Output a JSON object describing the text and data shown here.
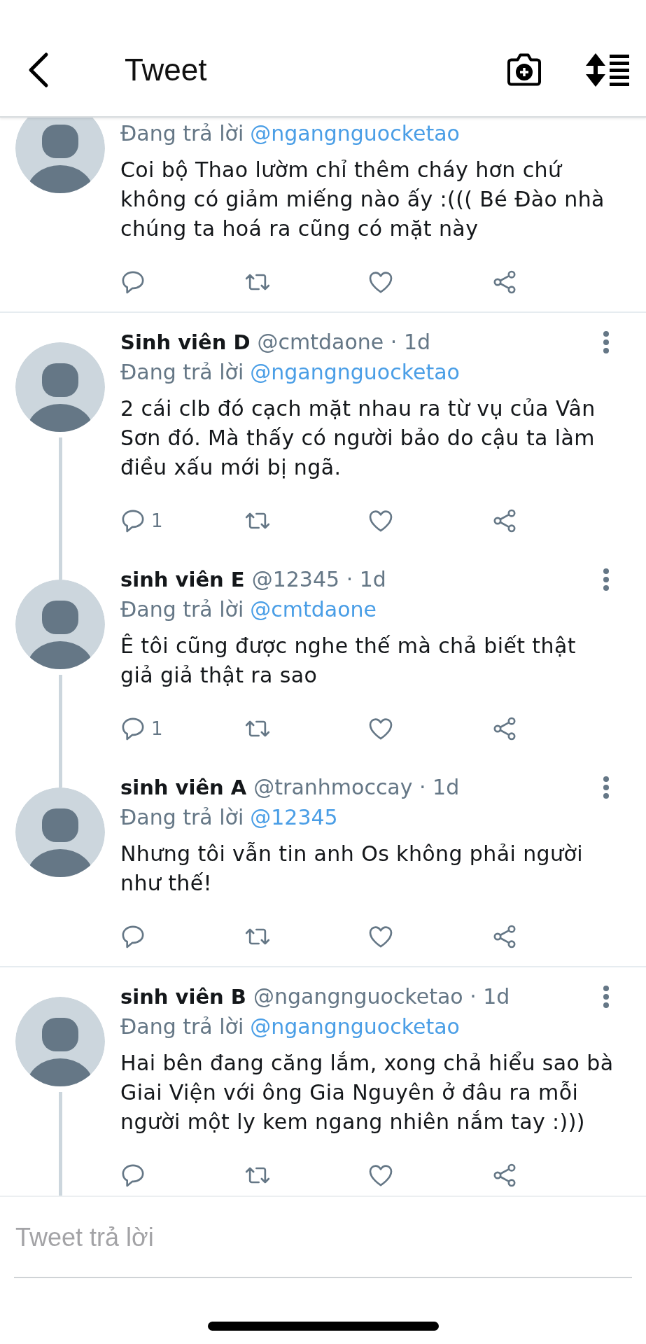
{
  "header": {
    "title": "Tweet"
  },
  "tweets": [
    {
      "reply_label": "Đang trả lời",
      "reply_to": "@ngangnguocketao",
      "text": "Coi bộ Thao lườm chỉ thêm cháy hơn chứ không có giảm miếng nào ấy :((( Bé Đào nhà chúng ta hoá ra cũng có mặt này",
      "thread_continues": false
    },
    {
      "name": "Sinh viên D",
      "meta": "@cmtdaone · 1d",
      "reply_label": "Đang trả lời",
      "reply_to": "@ngangnguocketao",
      "text": "2 cái clb đó cạch mặt nhau ra từ vụ của Vân Sơn đó. Mà thấy có người bảo do cậu ta làm điều xấu mới bị ngã.",
      "reply_count": "1",
      "thread_continues": true
    },
    {
      "name": "sinh viên E",
      "meta": "@12345 · 1d",
      "reply_label": "Đang trả lời",
      "reply_to": "@cmtdaone",
      "text": "Ê tôi cũng được nghe thế mà chả biết thật giả giả thật ra sao",
      "reply_count": "1",
      "thread_continues": true
    },
    {
      "name": "sinh viên A",
      "meta": "@tranhmoccay · 1d",
      "reply_label": "Đang trả lời",
      "reply_to": "@12345",
      "text": "Nhưng tôi vẫn tin anh Os không phải người như thế!",
      "thread_continues": false
    },
    {
      "name": "sinh viên B",
      "meta": "@ngangnguocketao · 1d",
      "reply_label": "Đang trả lời",
      "reply_to": "@ngangnguocketao",
      "text": "Hai bên đang căng lắm, xong chả hiểu sao bà Giai Viện với ông Gia Nguyên ở đâu ra mỗi người một ly kem ngang nhiên nắm tay :)))",
      "thread_continues": true
    }
  ],
  "reply_box": {
    "placeholder": "Tweet trả lời"
  }
}
